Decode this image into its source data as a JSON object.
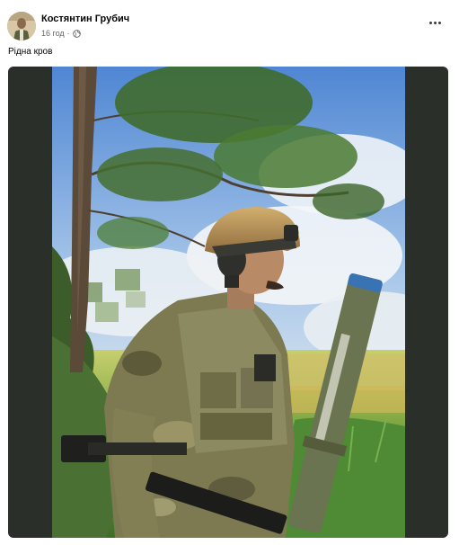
{
  "post": {
    "author": "Костянтин Грубич",
    "time": "16 год",
    "separator": "·",
    "caption": "Рідна кров"
  },
  "icons": {
    "privacy": "globe-icon",
    "more": "more-options-icon"
  },
  "colors": {
    "background": "#ffffff",
    "media_frame": "#2b2f2a",
    "meta_text": "#65676b"
  }
}
